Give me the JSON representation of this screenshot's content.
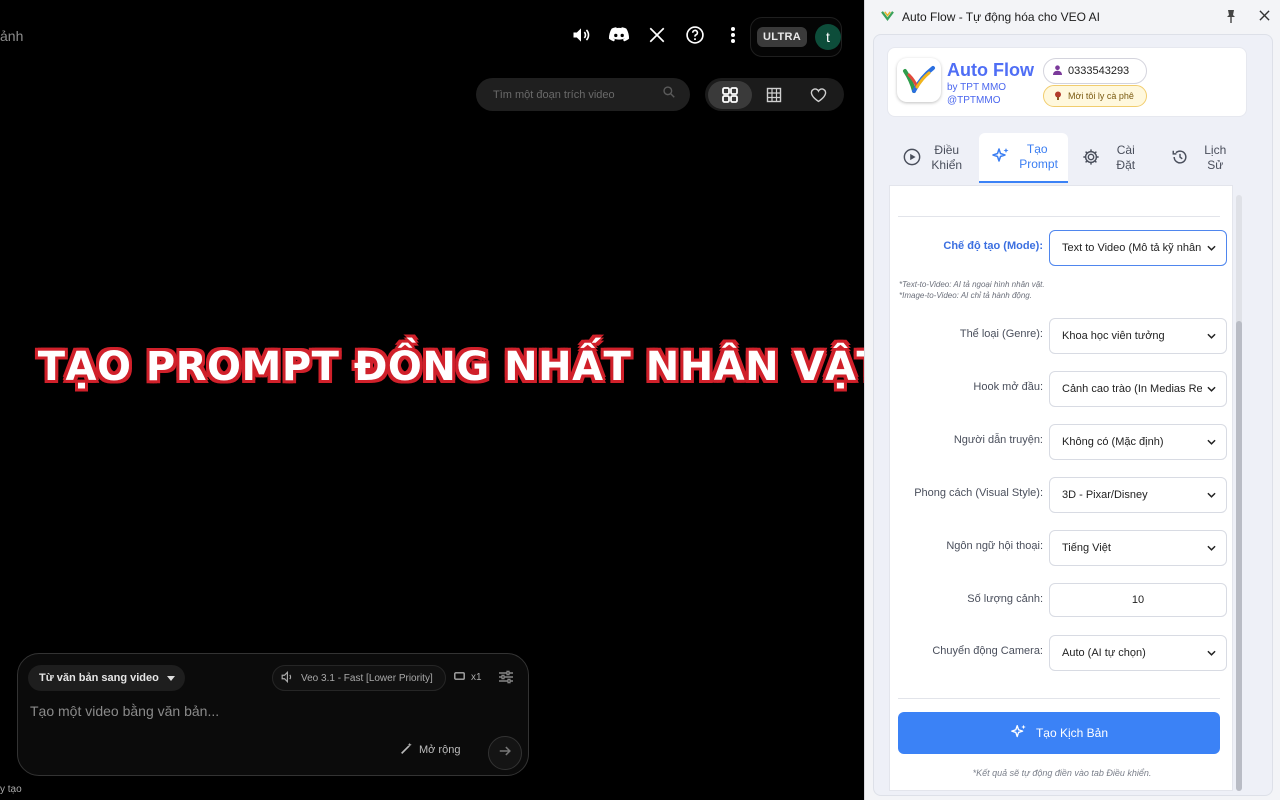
{
  "left_app": {
    "title_fragment": "ảnh",
    "top_icons": [
      "volume-icon",
      "discord-icon",
      "x-icon",
      "help-icon",
      "more-vert-icon"
    ],
    "plan_badge": "ULTRA",
    "avatar_letter": "t",
    "search_placeholder": "Tìm một đoạn trích video",
    "headline": "TẠO PROMPT ĐỒNG NHẤT NHÂN VẬT",
    "composer": {
      "mode_label": "Từ văn bản sang video",
      "model_label": "Veo 3.1 - Fast [Lower Priority]",
      "count_label": "x1",
      "placeholder": "Tạo một video bằng văn bản...",
      "expand_label": "Mở rộng"
    },
    "bottom_fragment": "y tạo"
  },
  "panel": {
    "window_title": "Auto Flow - Tự động hóa cho VEO AI",
    "brand": {
      "name": "Auto Flow",
      "by_line": "by TPT MMO",
      "handle": "@TPTMMO",
      "phone": "0333543293",
      "coffee": "Mời tôi ly cà phê"
    },
    "tabs": [
      {
        "label_line1": "Điều",
        "label_line2": "Khiển",
        "active": false
      },
      {
        "label_line1": "Tạo",
        "label_line2": "Prompt",
        "active": true
      },
      {
        "label_line1": "Cài",
        "label_line2": "Đặt",
        "active": false
      },
      {
        "label_line1": "Lịch",
        "label_line2": "Sử",
        "active": false
      }
    ],
    "form": {
      "mode": {
        "label": "Chế độ tạo (Mode):",
        "value": "Text to Video (Mô tả kỹ nhân vật)"
      },
      "hint1": "*Text-to-Video: AI tả ngoại hình nhân vật.",
      "hint2": "*Image-to-Video: AI chỉ tả hành động.",
      "genre": {
        "label": "Thể loại (Genre):",
        "value": "Khoa học viễn tưởng"
      },
      "hook": {
        "label": "Hook mở đầu:",
        "value": "Cảnh cao trào (In Medias Res)"
      },
      "narrator": {
        "label": "Người dẫn truyện:",
        "value": "Không có (Mặc định)"
      },
      "style": {
        "label": "Phong cách (Visual Style):",
        "value": "3D - Pixar/Disney"
      },
      "language": {
        "label": "Ngôn ngữ hội thoại:",
        "value": "Tiếng Việt"
      },
      "scenes": {
        "label": "Số lượng cảnh:",
        "value": "10"
      },
      "camera": {
        "label": "Chuyển động Camera:",
        "value": "Auto (AI tự chọn)"
      }
    },
    "generate_button": "Tạo Kịch Bản",
    "footer_note": "*Kết quả sẽ tự động điền vào tab Điều khiển."
  },
  "colors": {
    "accent": "#3b82f6",
    "brand_text": "#4f6ef5",
    "headline_outline": "#d0202a"
  }
}
